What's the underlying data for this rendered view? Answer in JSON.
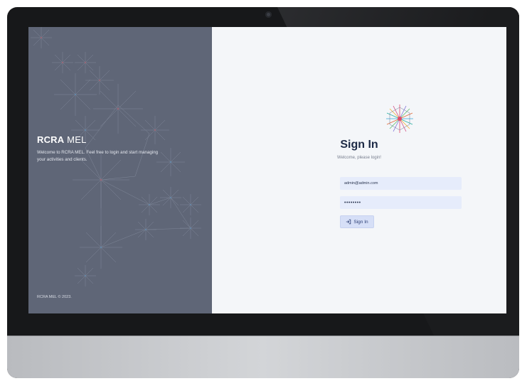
{
  "brand": {
    "strong": "RCRA",
    "light": " MEL"
  },
  "left_panel": {
    "tagline": "Welcome to RCRA MEL. Feel free to login and start managing your activities and clients.",
    "copyright": "RCRA MEL © 2023."
  },
  "login": {
    "title": "Sign In",
    "subtitle": "Welcome, please login!",
    "email_value": "admin@admin.com",
    "password_value": "••••••••",
    "button_label": "Sign In"
  },
  "icons": {
    "logo": "sunburst-logo-icon",
    "button": "sign-in-arrow-icon"
  },
  "colors": {
    "left_panel": "#5f6677",
    "screen_bg": "#f4f6f9",
    "field_bg": "#e6ecfb",
    "button_bg": "#d6dff7",
    "title": "#1d2a46"
  }
}
